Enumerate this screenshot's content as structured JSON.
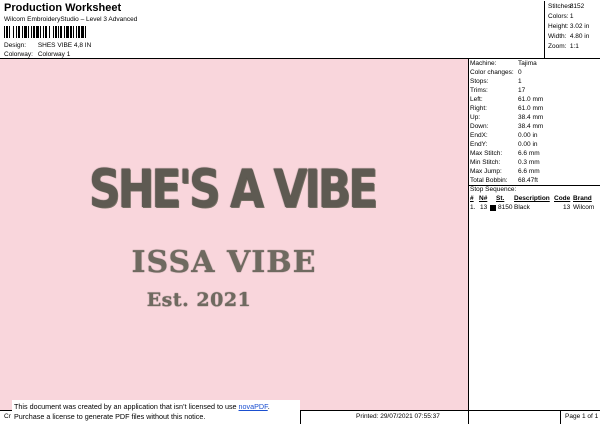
{
  "header": {
    "title": "Production Worksheet",
    "subtitle": "Wilcom EmbroideryStudio – Level 3 Advanced",
    "design_label": "Design:",
    "design_value": "SHES VIBE 4,8 IN",
    "colorway_label": "Colorway:",
    "colorway_value": "Colorway 1"
  },
  "summary": [
    {
      "label": "Stitches:",
      "value": "8152"
    },
    {
      "label": "Colors:",
      "value": "1"
    },
    {
      "label": "Height:",
      "value": "3.02 in"
    },
    {
      "label": "Width:",
      "value": "4.80 in"
    },
    {
      "label": "Zoom:",
      "value": "1:1"
    }
  ],
  "design": {
    "line1": "SHE'S A VIBE",
    "line2": "ISSA VIBE",
    "line3": "Est. 2021",
    "background": "#f9d6dc",
    "thread_color": "#6f6a60"
  },
  "machine_info": [
    {
      "label": "Machine:",
      "value": "Tajima"
    },
    {
      "label": "Color changes:",
      "value": "0"
    },
    {
      "label": "Stops:",
      "value": "1"
    },
    {
      "label": "Trims:",
      "value": "17"
    },
    {
      "label": "Left:",
      "value": "61.0 mm"
    },
    {
      "label": "Right:",
      "value": "61.0 mm"
    },
    {
      "label": "Up:",
      "value": "38.4 mm"
    },
    {
      "label": "Down:",
      "value": "38.4 mm"
    },
    {
      "label": "EndX:",
      "value": "0.00 in"
    },
    {
      "label": "EndY:",
      "value": "0.00 in"
    },
    {
      "label": "Max Stitch:",
      "value": "6.6 mm"
    },
    {
      "label": "Min Stitch:",
      "value": "0.3 mm"
    },
    {
      "label": "Max Jump:",
      "value": "6.6 mm"
    },
    {
      "label": "Total Bobbin:",
      "value": "68.47ft"
    }
  ],
  "stop_sequence": {
    "title": "Stop Sequence:",
    "headers": [
      "#",
      "N#",
      "St.",
      "Description",
      "Code",
      "Brand"
    ],
    "rows": [
      {
        "num": "1.",
        "needle": "13",
        "stitches": "8150",
        "description": "Black",
        "code": "13",
        "brand": "Wilcom"
      }
    ]
  },
  "footer": {
    "notice_line1_prefix": "This document was created by an application that isn’t licensed to use ",
    "notice_link": "novaPDF",
    "notice_line1_suffix": ".",
    "notice_line2": "Purchase a license to generate PDF files without this notice.",
    "cr": "Cr",
    "printed": "Printed: 29/07/2021 07:55:37",
    "page": "Page 1 of 1"
  }
}
